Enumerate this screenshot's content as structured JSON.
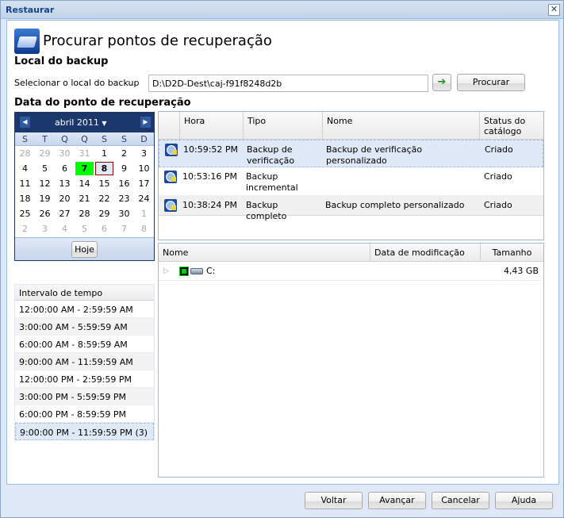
{
  "window": {
    "title": "Restaurar",
    "close_icon": "close-icon"
  },
  "page": {
    "title": "Procurar pontos de recuperação"
  },
  "backup_location": {
    "heading": "Local do backup",
    "label": "Selecionar o local do backup",
    "path": "D:\\D2D-Dest\\caj-f91f8248d2b",
    "go_icon": "arrow-right-icon",
    "browse_label": "Procurar"
  },
  "recovery_date": {
    "heading": "Data do ponto de recuperação"
  },
  "calendar": {
    "month": "abril 2011",
    "prev": "◀",
    "next": "▶",
    "dropdown": "▼",
    "day_names": [
      "S",
      "T",
      "Q",
      "Q",
      "S",
      "S",
      "D"
    ],
    "weeks": [
      [
        "28",
        "29",
        "30",
        "31",
        "1",
        "2",
        "3"
      ],
      [
        "4",
        "5",
        "6",
        "7",
        "8",
        "9",
        "10"
      ],
      [
        "11",
        "12",
        "13",
        "14",
        "15",
        "16",
        "17"
      ],
      [
        "18",
        "19",
        "20",
        "21",
        "22",
        "23",
        "24"
      ],
      [
        "25",
        "26",
        "27",
        "28",
        "29",
        "30",
        "1"
      ],
      [
        "2",
        "3",
        "4",
        "5",
        "6",
        "7",
        "8"
      ]
    ],
    "selected_day": "7",
    "today": "8",
    "today_label": "Hoje"
  },
  "time_intervals": {
    "header": "Intervalo de tempo",
    "items": [
      "12:00:00 AM - 2:59:59 AM",
      "3:00:00 AM - 5:59:59 AM",
      "6:00:00 AM - 8:59:59 AM",
      "9:00:00 AM - 11:59:59 AM",
      "12:00:00 PM - 2:59:59 PM",
      "3:00:00 PM - 5:59:59 PM",
      "6:00:00 PM - 8:59:59 PM",
      "9:00:00 PM - 11:59:59 PM (3)"
    ],
    "selected_index": 7
  },
  "recovery_points": {
    "columns": [
      "Hora",
      "Tipo",
      "Nome",
      "Status do catálogo"
    ],
    "rows": [
      {
        "time": "10:59:52 PM",
        "type": "Backup de verificação",
        "name": "Backup de verificação personalizado",
        "status": "Criado"
      },
      {
        "time": "10:53:16 PM",
        "type": "Backup incremental",
        "name": "",
        "status": "Criado"
      },
      {
        "time": "10:38:24 PM",
        "type": "Backup completo",
        "name": "Backup completo personalizado",
        "status": "Criado"
      }
    ]
  },
  "files": {
    "columns": [
      "Nome",
      "Data de modificação",
      "Tamanho"
    ],
    "rows": [
      {
        "name": "C:",
        "modified": "",
        "size": "4,43 GB"
      }
    ]
  },
  "footer": {
    "back": "Voltar",
    "next": "Avançar",
    "cancel": "Cancelar",
    "help": "Ajuda"
  }
}
